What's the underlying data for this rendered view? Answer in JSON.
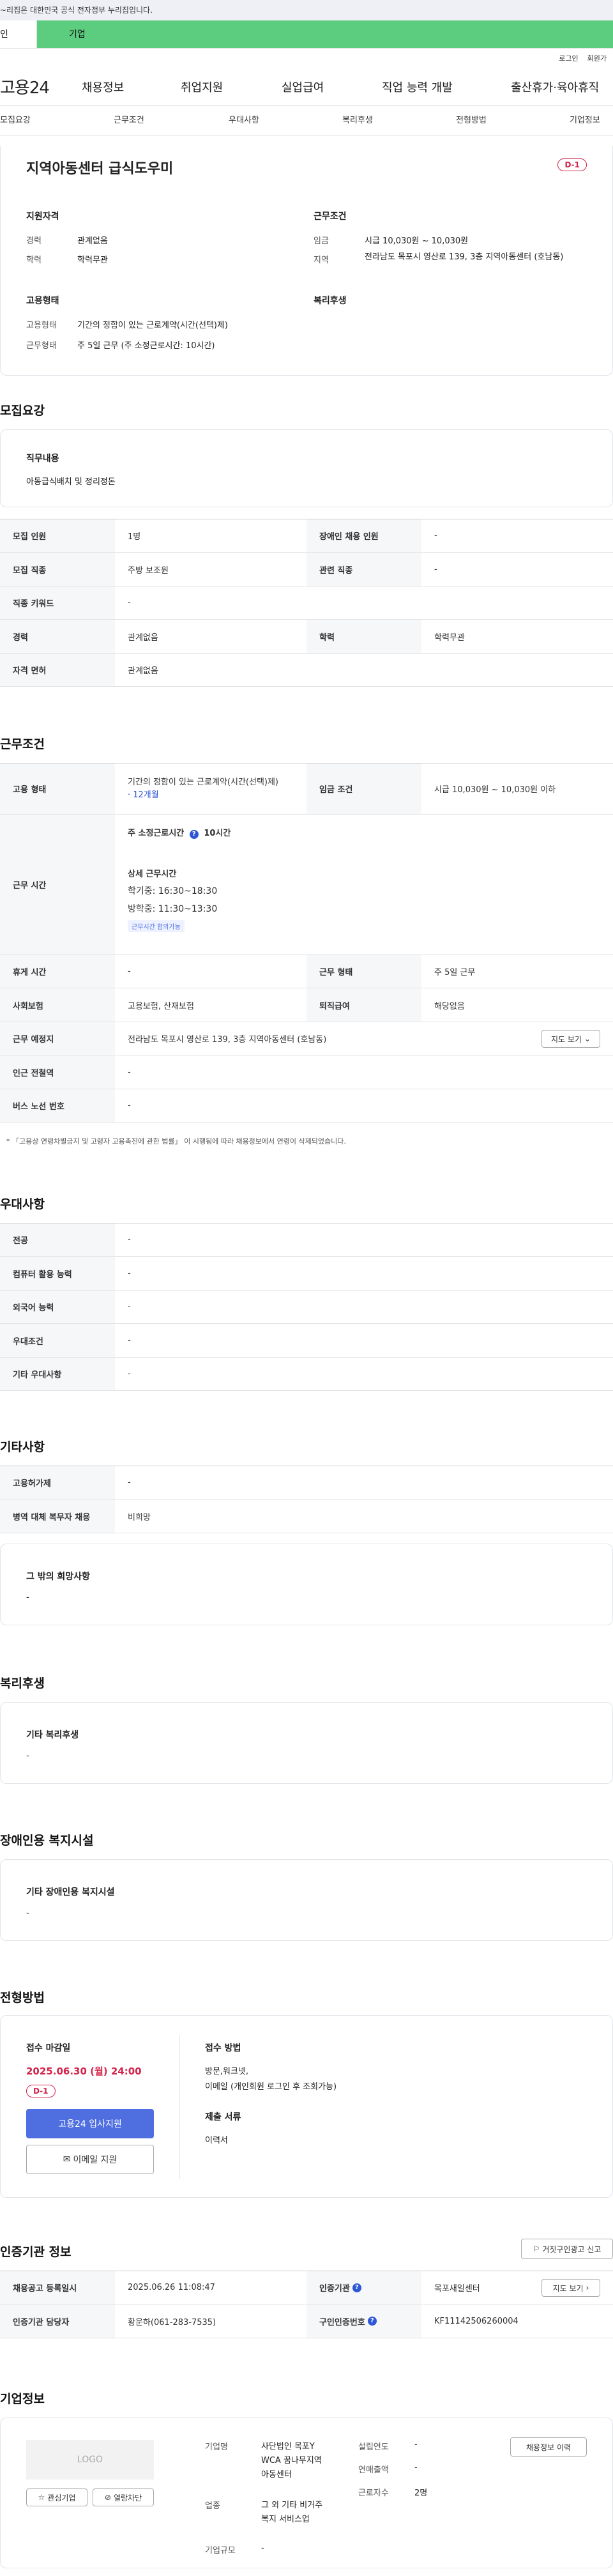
{
  "gov_banner": "~리집은 대한민국 공식 전자정부 누리집입니다.",
  "top_tabs": {
    "personal": "인",
    "company": "기업"
  },
  "util": {
    "login": "로그인",
    "signup": "회원가"
  },
  "gnb": {
    "logo": "고용24",
    "menu": [
      "채용정보",
      "취업지원",
      "실업급여",
      "직업 능력 개발",
      "출산휴가·육아휴직"
    ]
  },
  "subnav": [
    "모집요강",
    "근무조건",
    "우대사항",
    "복리후생",
    "전형방법",
    "기업정보"
  ],
  "summary": {
    "title": "지역아동센터 급식도우미",
    "dday": "D-1",
    "qual_title": "지원자격",
    "qual": [
      {
        "k": "경력",
        "v": "관계없음"
      },
      {
        "k": "학력",
        "v": "학력무관"
      }
    ],
    "cond_title": "근무조건",
    "cond": [
      {
        "k": "임금",
        "v": "시급 10,030원 ~ 10,030원"
      },
      {
        "k": "지역",
        "v": "전라남도 목포시 영산로 139, 3층 지역아동센터 (호남동)"
      }
    ],
    "emp_title": "고용형태",
    "emp": [
      {
        "k": "고용형태",
        "v": "기간의 정함이 있는 근로계약(시간(선택)제)"
      },
      {
        "k": "근무형태",
        "v": "주 5일 근무 (주 소정근로시간: 10시간)"
      }
    ],
    "welfare_title": "복리후생"
  },
  "recruit": {
    "heading": "모집요강",
    "duty_label": "직무내용",
    "duty_value": "아동급식배치 및 정리정돈",
    "rows": [
      {
        "k1": "모집 인원",
        "v1": "1명",
        "k2": "장애인 채용 인원",
        "v2": "-"
      },
      {
        "k1": "모집 직종",
        "v1": "주방 보조원",
        "k2": "관련 직종",
        "v2": "-"
      },
      {
        "k1": "직종 키워드",
        "v1": "-"
      },
      {
        "k1": "경력",
        "v1": "관계없음",
        "k2": "학력",
        "v2": "학력무관"
      },
      {
        "k1": "자격 면허",
        "v1": "관계없음"
      }
    ]
  },
  "work": {
    "heading": "근무조건",
    "emp_type_k": "고용 형태",
    "emp_type_v": "기간의 정함이 있는 근로계약(시간(선택)제)",
    "emp_type_period": "· 12개월",
    "wage_k": "임금 조건",
    "wage_v": "시급 10,030원 ~ 10,030원 이하",
    "hours_k": "근무 시간",
    "hours_week": "주 소정근로시간",
    "hours_week_v": "10시간",
    "hours_detail_title": "상세 근무시간",
    "hours_detail": [
      "학기중: 16:30~18:30",
      "방학중: 11:30~13:30"
    ],
    "hours_badge": "근무시간 협의가능",
    "rows": [
      {
        "k1": "휴게 시간",
        "v1": "-",
        "k2": "근무 형태",
        "v2": "주 5일 근무"
      },
      {
        "k1": "사회보험",
        "v1": "고용보험, 산재보험",
        "k2": "퇴직급여",
        "v2": "해당없음"
      }
    ],
    "place_k": "근무 예정지",
    "place_v": "전라남도 목포시 영산로 139, 3층 지역아동센터 (호남동)",
    "map_btn": "지도 보기",
    "station_k": "인근 전철역",
    "station_v": "-",
    "bus_k": "버스 노선 번호",
    "bus_v": "-",
    "note": "「고용상 연령차별금지 및 고령자 고용촉진에 관한 법률」 이 시행됨에 따라 채용정보에서 연령이 삭제되었습니다."
  },
  "pref": {
    "heading": "우대사항",
    "rows": [
      {
        "k": "전공",
        "v": "-"
      },
      {
        "k": "컴퓨터 활용 능력",
        "v": "-"
      },
      {
        "k": "외국어 능력",
        "v": "-"
      },
      {
        "k": "우대조건",
        "v": "-"
      },
      {
        "k": "기타 우대사항",
        "v": "-"
      }
    ]
  },
  "etc": {
    "heading": "기타사항",
    "rows": [
      {
        "k": "고용허가제",
        "v": "-"
      },
      {
        "k": "병역 대체 복무자 채용",
        "v": "비희망"
      }
    ],
    "other_label": "그 밖의 희망사항",
    "other_value": "-"
  },
  "welfare": {
    "heading": "복리후생",
    "label": "기타 복리후생",
    "value": "-"
  },
  "disabled": {
    "heading": "장애인용 복지시설",
    "label": "기타 장애인용 복지시설",
    "value": "-"
  },
  "selection": {
    "heading": "전형방법",
    "deadline_label": "접수 마감일",
    "deadline": "2025.06.30 (월) 24:00",
    "dday": "D-1",
    "apply_btn": "고용24 입사지원",
    "email_btn": "이메일 지원",
    "method_label": "접수 방법",
    "method_value": "방문,워크넷,",
    "method_value2": "이메일 (개인회원 로그인 후 조회가능)",
    "docs_label": "제출 서류",
    "docs_value": "이력서"
  },
  "cert": {
    "heading": "인증기관 정보",
    "report_btn": "거짓구인광고 신고",
    "rows": [
      {
        "k1": "채용공고 등록일시",
        "v1": "2025.06.26 11:08:47",
        "k2": "인증기관",
        "v2": "목포새일센터"
      },
      {
        "k1": "인증기관 담당자",
        "v1": "황운하(061-283-7535)",
        "k2": "구인인증번호",
        "v2": "KF11142506260004"
      }
    ],
    "map_btn": "지도 보기"
  },
  "company": {
    "heading": "기업정보",
    "logo": "LOGO",
    "fav_btn": "관심기업",
    "block_btn": "열람차단",
    "info_btn": "채용정보 이력",
    "name_k": "기업명",
    "name_v": [
      "사단법인 목포Y",
      "WCA 꿈나무지역",
      "아동센터"
    ],
    "found_k": "설립연도",
    "found_v": "-",
    "sales_k": "연매출액",
    "sales_v": "-",
    "emp_k": "근로자수",
    "emp_v": "2명",
    "ind_k": "업종",
    "ind_v": [
      "그 외 기타 비거주",
      "복지 서비스업"
    ],
    "size_k": "기업규모",
    "size_v": "-"
  },
  "colors": {
    "accent": "#4f6fe0",
    "green": "#5ccd7e",
    "red": "#d4234a"
  }
}
